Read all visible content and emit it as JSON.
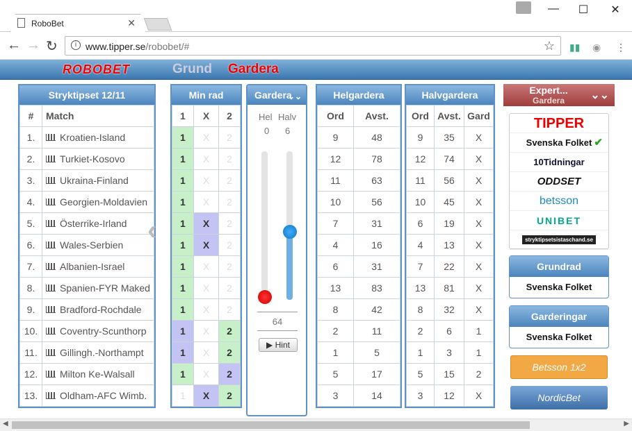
{
  "browser": {
    "tab_title": "RoboBet",
    "url_domain": "www.tipper.se",
    "url_path": "/robobet/#"
  },
  "header": {
    "logo": "ROBOBET",
    "nav_grund": "Grund",
    "nav_gardera": "Gardera"
  },
  "stryktips": {
    "title": "Stryktipset 12/11",
    "col_num": "#",
    "col_match": "Match",
    "rows": [
      {
        "n": "1.",
        "match": "Kroatien-Island"
      },
      {
        "n": "2.",
        "match": "Turkiet-Kosovo"
      },
      {
        "n": "3.",
        "match": "Ukraina-Finland"
      },
      {
        "n": "4.",
        "match": "Georgien-Moldavien"
      },
      {
        "n": "5.",
        "match": "Österrike-Irland"
      },
      {
        "n": "6.",
        "match": "Wales-Serbien"
      },
      {
        "n": "7.",
        "match": "Albanien-Israel"
      },
      {
        "n": "8.",
        "match": "Spanien-FYR Maked"
      },
      {
        "n": "9.",
        "match": "Bradford-Rochdale"
      },
      {
        "n": "10.",
        "match": "Coventry-Scunthorp"
      },
      {
        "n": "11.",
        "match": "Gillingh.-Northampt"
      },
      {
        "n": "12.",
        "match": "Milton Ke-Walsall"
      },
      {
        "n": "13.",
        "match": "Oldham-AFC Wimb."
      }
    ]
  },
  "minrad": {
    "title": "Min rad",
    "cols": [
      "1",
      "X",
      "2"
    ],
    "rows": [
      [
        "g",
        "e",
        "e"
      ],
      [
        "g",
        "e",
        "e"
      ],
      [
        "g",
        "e",
        "e"
      ],
      [
        "g",
        "e",
        "e"
      ],
      [
        "g",
        "p",
        "e"
      ],
      [
        "g",
        "p",
        "e"
      ],
      [
        "g",
        "e",
        "e"
      ],
      [
        "g",
        "e",
        "e"
      ],
      [
        "g",
        "e",
        "e"
      ],
      [
        "p",
        "e",
        "g"
      ],
      [
        "p",
        "e",
        "g"
      ],
      [
        "g",
        "e",
        "p"
      ],
      [
        "e",
        "p",
        "g"
      ]
    ]
  },
  "gardera": {
    "title": "Gardera",
    "hel_label": "Hel",
    "halv_label": "Halv",
    "hel_value": "0",
    "halv_value": "6",
    "total": "64",
    "hint": "▶ Hint"
  },
  "helgardera": {
    "title": "Helgardera",
    "cols": [
      "Ord",
      "Avst."
    ],
    "rows": [
      [
        "9",
        "48"
      ],
      [
        "12",
        "78"
      ],
      [
        "11",
        "63"
      ],
      [
        "10",
        "56"
      ],
      [
        "7",
        "31"
      ],
      [
        "4",
        "16"
      ],
      [
        "6",
        "31"
      ],
      [
        "13",
        "83"
      ],
      [
        "8",
        "42"
      ],
      [
        "2",
        "11"
      ],
      [
        "1",
        "5"
      ],
      [
        "5",
        "17"
      ],
      [
        "3",
        "14"
      ]
    ]
  },
  "halvgardera": {
    "title": "Halvgardera",
    "cols": [
      "Ord",
      "Avst.",
      "Gard"
    ],
    "rows": [
      [
        "9",
        "35",
        "X"
      ],
      [
        "12",
        "74",
        "X"
      ],
      [
        "11",
        "56",
        "X"
      ],
      [
        "10",
        "45",
        "X"
      ],
      [
        "6",
        "19",
        "X"
      ],
      [
        "4",
        "13",
        "X"
      ],
      [
        "7",
        "22",
        "X"
      ],
      [
        "13",
        "81",
        "X"
      ],
      [
        "8",
        "32",
        "X"
      ],
      [
        "2",
        "6",
        "1"
      ],
      [
        "1",
        "3",
        "1"
      ],
      [
        "5",
        "15",
        "2"
      ],
      [
        "3",
        "12",
        "X"
      ]
    ]
  },
  "expert": {
    "line1": "Expert...",
    "line2": "Gardera",
    "sources": [
      "TIPPER",
      "Svenska Folket",
      "10Tidningar",
      "ODDSET",
      "betsson",
      "UNIBET",
      "stryktipsetsistaschand.se"
    ]
  },
  "grundrad": {
    "title": "Grundrad",
    "logo": "Svenska Folket"
  },
  "garderingar": {
    "title": "Garderingar",
    "logo": "Svenska Folket"
  },
  "buttons": {
    "betsson": "Betsson 1x2",
    "nordicbet": "NordicBet"
  },
  "colors": {
    "accent": "#4a84bd",
    "green": "#c8f0c8",
    "purple": "#c4c4f4",
    "expert": "#a03c3c",
    "betsson": "#f3a846"
  }
}
